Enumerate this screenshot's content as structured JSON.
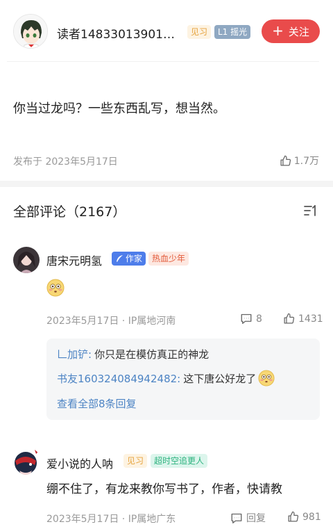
{
  "author": {
    "name": "读者14833013901…",
    "badge_trainee": "见习",
    "badge_level": "L1 摇光",
    "follow_label": "关注"
  },
  "post": {
    "text": "你当过龙吗？一些东西乱写，想当然。",
    "date": "发布于 2023年5月17日",
    "likes": "1.7万"
  },
  "comments_section": {
    "title": "全部评论（2167）"
  },
  "comments": [
    {
      "name": "唐宋元明氢",
      "badges": [
        "作家",
        "热血少年"
      ],
      "date_loc": "2023年5月17日 · IP属地河南",
      "reply_count": "8",
      "likes": "1431",
      "replies": [
        {
          "author": "𠃊加铲:",
          "text": "你只是在模仿真正的神龙"
        },
        {
          "author": "书友160324084942482:",
          "text": "这下唐公好龙了"
        }
      ],
      "more_replies": "查看全部8条回复"
    },
    {
      "name": "爱小说的人呐",
      "badges": [
        "见习",
        "超时空追更人"
      ],
      "text": "绷不住了，有龙来教你写书了，作者，快请教",
      "date_loc": "2023年5月17日 · IP属地广东",
      "reply_label": "回复",
      "likes": "981"
    }
  ],
  "colors": {
    "accent_red": "#e94b4b",
    "link_blue": "#4d84c4",
    "author_blue": "#4e7dea"
  },
  "icons": [
    "avatar-anime",
    "plus-icon",
    "thumb-up-icon",
    "sort-icon",
    "comment-icon",
    "quill-icon",
    "flushed-face-emoji"
  ]
}
